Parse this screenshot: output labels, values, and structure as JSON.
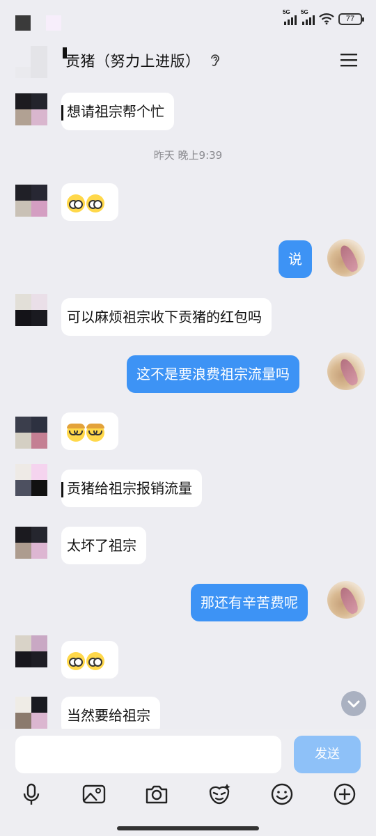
{
  "status": {
    "net1": "5G",
    "net2": "5G",
    "battery": "77"
  },
  "chat": {
    "title": "贡猪（努力上进版）"
  },
  "messages": [
    {
      "id": "m1",
      "from": "other",
      "text": "想请祖宗帮个忙"
    },
    {
      "id": "t1",
      "type": "time",
      "text": "昨天 晚上9:39"
    },
    {
      "id": "m2",
      "from": "other",
      "emoji": [
        "pleading-face-icon",
        "pleading-face-icon"
      ]
    },
    {
      "id": "m3",
      "from": "me",
      "text": "说"
    },
    {
      "id": "m4",
      "from": "other",
      "text": "可以麻烦祖宗收下贡猪的红包吗"
    },
    {
      "id": "m5",
      "from": "me",
      "text": "这不是要浪费祖宗流量吗"
    },
    {
      "id": "m6",
      "from": "other",
      "emoji": [
        "squint-face-icon",
        "squint-face-icon"
      ]
    },
    {
      "id": "m7",
      "from": "other",
      "text": "贡猪给祖宗报销流量"
    },
    {
      "id": "m8",
      "from": "other",
      "text": "太坏了祖宗"
    },
    {
      "id": "m9",
      "from": "me",
      "text": "那还有辛苦费呢"
    },
    {
      "id": "m10",
      "from": "other",
      "emoji": [
        "pleading-face-icon",
        "pleading-face-icon"
      ]
    },
    {
      "id": "m11",
      "from": "other",
      "text": "当然要给祖宗"
    }
  ],
  "composer": {
    "value": "",
    "send_label": "发送"
  },
  "toolbar": {
    "icons": [
      "microphone-icon",
      "image-icon",
      "camera-icon",
      "sticker-icon",
      "emoji-icon",
      "plus-icon"
    ]
  },
  "colors": {
    "bubble_me": "#3d93f5",
    "bubble_other": "#ffffff",
    "background": "#ededf2",
    "send_disabled": "#8ec1f8"
  }
}
